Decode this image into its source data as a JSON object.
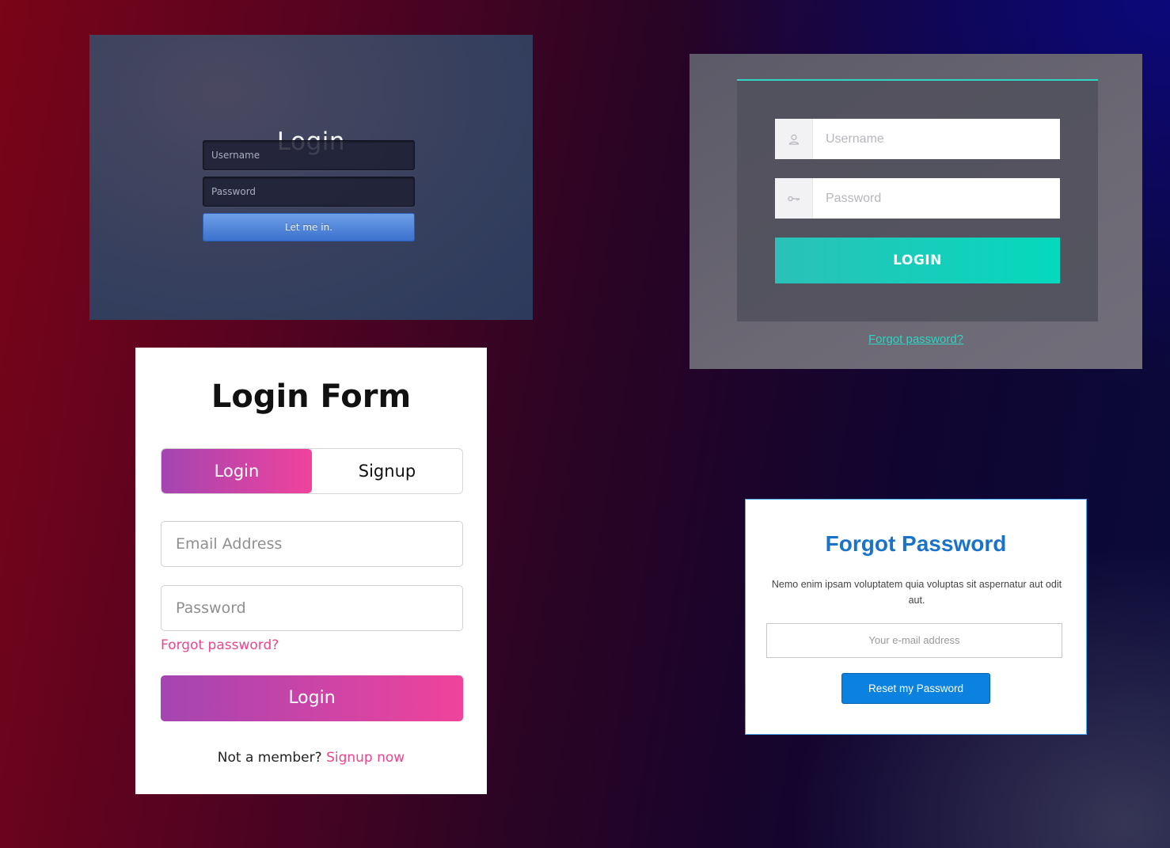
{
  "panel1": {
    "title": "Login",
    "username_placeholder": "Username",
    "password_placeholder": "Password",
    "submit_label": "Let me in."
  },
  "panel2": {
    "username_placeholder": "Username",
    "password_placeholder": "Password",
    "user_icon": "user-icon",
    "key_icon": "key-icon",
    "submit_label": "LOGIN",
    "forgot_label": "Forgot password?",
    "accent": "#2fd4c3"
  },
  "panel3": {
    "title": "Login Form",
    "tabs": [
      {
        "label": "Login"
      },
      {
        "label": "Signup"
      }
    ],
    "email_placeholder": "Email Address",
    "password_placeholder": "Password",
    "forgot_label": "Forgot password?",
    "submit_label": "Login",
    "member_text": "Not a member?",
    "signup_link": "Signup now",
    "accent_from": "#a445b2",
    "accent_to": "#f0439c"
  },
  "panel4": {
    "title": "Forgot Password",
    "description": "Nemo enim ipsam voluptatem quia voluptas sit aspernatur aut odit aut.",
    "email_placeholder": "Your e-mail address",
    "submit_label": "Reset my Password",
    "accent": "#0b82e0"
  }
}
